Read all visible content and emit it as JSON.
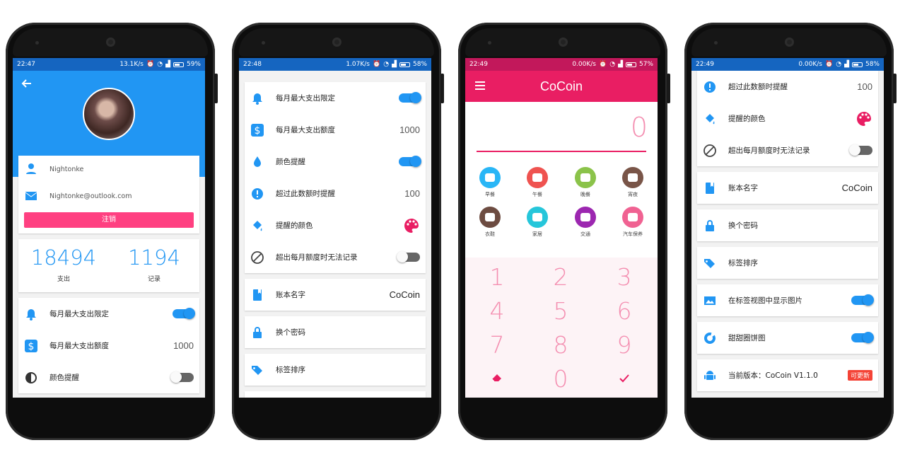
{
  "screen1": {
    "status": {
      "time": "22:47",
      "speed": "13.1K/s",
      "battery": "59%"
    },
    "username": "Nightonke",
    "email": "Nightonke@outlook.com",
    "logout": "注销",
    "stat_expense": "18494",
    "stat_expense_label": "支出",
    "stat_records": "1194",
    "stat_records_label": "记录",
    "settings": [
      {
        "label": "每月最大支出限定",
        "toggle": "on"
      },
      {
        "label": "每月最大支出额度",
        "value": "1000"
      },
      {
        "label": "颜色提醒",
        "toggle": "off"
      }
    ]
  },
  "screen2": {
    "status": {
      "time": "22:48",
      "speed": "1.07K/s",
      "battery": "58%"
    },
    "settings": [
      {
        "label": "每月最大支出限定",
        "toggle": "on"
      },
      {
        "label": "每月最大支出额度",
        "value": "1000"
      },
      {
        "label": "颜色提醒",
        "toggle": "on"
      },
      {
        "label": "超过此数额时提醒",
        "value": "100"
      },
      {
        "label": "提醒的颜色"
      },
      {
        "label": "超出每月额度时无法记录",
        "toggle": "off"
      }
    ],
    "account_name_label": "账本名字",
    "account_name": "CoCoin",
    "change_password": "换个密码",
    "tag_sort": "标签排序"
  },
  "screen3": {
    "status": {
      "time": "22:49",
      "speed": "0.00K/s",
      "battery": "57%"
    },
    "title": "CoCoin",
    "amount": "0",
    "categories": [
      {
        "label": "早餐",
        "color": "#29b6f6"
      },
      {
        "label": "午餐",
        "color": "#ef5350"
      },
      {
        "label": "晚餐",
        "color": "#8bc34a"
      },
      {
        "label": "宵夜",
        "color": "#795548"
      },
      {
        "label": "衣鞋",
        "color": "#6d4c41"
      },
      {
        "label": "家居",
        "color": "#26c6da"
      },
      {
        "label": "交通",
        "color": "#9c27b0"
      },
      {
        "label": "汽车保养",
        "color": "#f06292"
      }
    ],
    "keys": [
      "1",
      "2",
      "3",
      "4",
      "5",
      "6",
      "7",
      "8",
      "9",
      "0"
    ]
  },
  "screen4": {
    "status": {
      "time": "22:49",
      "speed": "0.00K/s",
      "battery": "58%"
    },
    "settings": [
      {
        "label": "超过此数额时提醒",
        "value": "100"
      },
      {
        "label": "提醒的颜色"
      },
      {
        "label": "超出每月额度时无法记录",
        "toggle": "off"
      }
    ],
    "account_name_label": "账本名字",
    "account_name": "CoCoin",
    "change_password": "换个密码",
    "tag_sort": "标签排序",
    "show_images": "在标签视图中显示图片",
    "donut": "甜甜圈饼图",
    "version": "当前版本：CoCoin V1.1.0",
    "update_badge": "可更新"
  },
  "colors": {
    "blue": "#2196f3",
    "pink": "#e91e63",
    "accent": "#ff4081"
  }
}
